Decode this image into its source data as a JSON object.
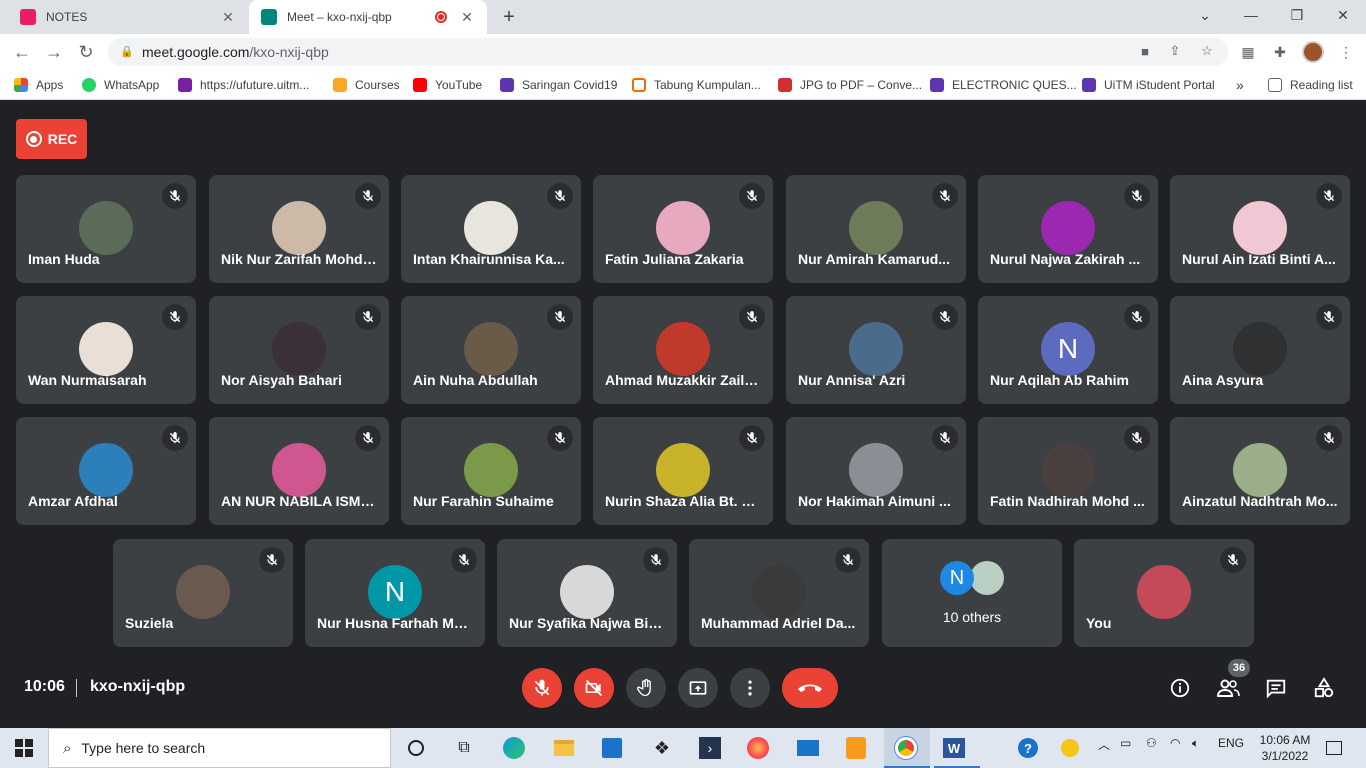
{
  "browser": {
    "tabs": [
      {
        "title": "NOTES",
        "active": false,
        "favicon_color": "#e91e63"
      },
      {
        "title": "Meet – kxo-nxij-qbp",
        "active": true,
        "favicon_color": "#00897b"
      }
    ],
    "url_host": "meet.google.com",
    "url_path": "/kxo-nxij-qbp",
    "bookmarks": [
      {
        "label": "Apps",
        "color": "#4285f4"
      },
      {
        "label": "WhatsApp",
        "color": "#25d366"
      },
      {
        "label": "https://ufuture.uitm...",
        "color": "#7b1fa2"
      },
      {
        "label": "Courses",
        "color": "#f9a825"
      },
      {
        "label": "YouTube",
        "color": "#ff0000"
      },
      {
        "label": "Saringan Covid19",
        "color": "#5e35b1"
      },
      {
        "label": "Tabung Kumpulan...",
        "color": "#ef6c00"
      },
      {
        "label": "JPG to PDF – Conve...",
        "color": "#d32f2f"
      },
      {
        "label": "ELECTRONIC QUES...",
        "color": "#5e35b1"
      },
      {
        "label": "UiTM iStudent Portal",
        "color": "#5e35b1"
      }
    ],
    "bookmarks_more": "»",
    "reading_list": "Reading list"
  },
  "meet": {
    "rec_label": "REC",
    "participants": [
      {
        "name": "Iman Huda",
        "avatar": "#5b6b5a"
      },
      {
        "name": "Nik Nur Zarifah Mohd ...",
        "avatar": "#cdb9a8"
      },
      {
        "name": "Intan Khairunnisa Ka...",
        "avatar": "#e8e4de"
      },
      {
        "name": "Fatin Juliana Zakaria",
        "avatar": "#e7a9c0"
      },
      {
        "name": "Nur Amirah Kamarud...",
        "avatar": "#6f7c5a"
      },
      {
        "name": "Nurul Najwa Zakirah ...",
        "avatar": "#9c27b0"
      },
      {
        "name": "Nurul Ain Izati Binti A...",
        "avatar": "#f0c8d4"
      },
      {
        "name": "Wan Nurmaisarah",
        "avatar": "#e9dfd6"
      },
      {
        "name": "Nor Aisyah Bahari",
        "avatar": "#3b2f3a"
      },
      {
        "name": "Ain Nuha Abdullah",
        "avatar": "#6a5a48"
      },
      {
        "name": "Ahmad Muzakkir Zaila...",
        "avatar": "#c0392b"
      },
      {
        "name": "Nur Annisa' Azri",
        "avatar": "#4a6b8a"
      },
      {
        "name": "Nur Aqilah Ab Rahim",
        "avatar": "#5c6bc0",
        "initial": "N"
      },
      {
        "name": "Aina Asyura",
        "avatar": "#2f3032"
      },
      {
        "name": "Amzar Afdhal",
        "avatar": "#2c7fb8"
      },
      {
        "name": "AN NUR NABILA ISMA...",
        "avatar": "#d0568f"
      },
      {
        "name": "Nur Farahin Suhaime",
        "avatar": "#7a9a4a"
      },
      {
        "name": "Nurin Shaza Alia Bt. M...",
        "avatar": "#c9b32a"
      },
      {
        "name": "Nor Hakimah Aimuni ...",
        "avatar": "#8a8f96"
      },
      {
        "name": "Fatin Nadhirah Mohd ...",
        "avatar": "#4a4040"
      },
      {
        "name": "Ainzatul Nadhtrah Mo...",
        "avatar": "#9aae8a"
      },
      {
        "name": "Suziela",
        "avatar": "#6b5a4f"
      },
      {
        "name": "Nur Husna Farhah Mo...",
        "avatar": "#0097a7",
        "initial": "N"
      },
      {
        "name": "Nur Syafika Najwa Bin...",
        "avatar": "#d8d8d8"
      },
      {
        "name": "Muhammad Adriel Da...",
        "avatar": "#3a3a3a"
      },
      {
        "name": "You",
        "avatar": "#c44a5a"
      }
    ],
    "others": {
      "label": "10 others",
      "initial": "N"
    },
    "time": "10:06",
    "meeting_code": "kxo-nxij-qbp",
    "people_count": "36"
  },
  "taskbar": {
    "search_placeholder": "Type here to search",
    "language": "ENG",
    "time": "10:06 AM",
    "date": "3/1/2022"
  }
}
